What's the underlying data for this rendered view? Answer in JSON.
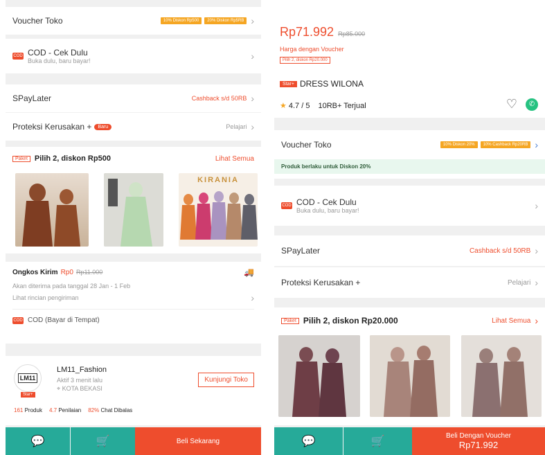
{
  "left": {
    "voucher": {
      "label": "Voucher Toko",
      "chips": [
        "10% Diskon Rp500",
        "20% Diskon Rp5RB"
      ]
    },
    "cod": {
      "title": "COD - Cek Dulu",
      "subtitle": "Buka dulu, baru bayar!",
      "icon": "COD"
    },
    "spaylater": {
      "label": "SPayLater",
      "value": "Cashback s/d 50RB"
    },
    "proteksi": {
      "label": "Proteksi Kerusakan +",
      "badge": "Baru",
      "value": "Pelajari"
    },
    "bundle": {
      "tag": "Paket",
      "title": "Pilih 2, diskon Rp500",
      "link": "Lihat Semua",
      "brand": "KIRANIA"
    },
    "shipping": {
      "label": "Ongkos Kirim",
      "price": "Rp0",
      "old": "Rp11.000",
      "eta": "Akan diterima pada tanggal 28 Jan - 1 Feb",
      "detail": "Lihat rincian pengiriman",
      "cod": "COD (Bayar di Tempat)",
      "cod_icon": "COD"
    },
    "shop": {
      "name": "LM11_Fashion",
      "active": "Aktif 3 menit lalu",
      "location": "KOTA BEKASI",
      "badge": "Star+",
      "logo": "LM11",
      "visit": "Kunjungi Toko",
      "stats": [
        {
          "num": "161",
          "label": "Produk"
        },
        {
          "num": "4.7",
          "label": "Penilaian"
        },
        {
          "num": "82%",
          "label": "Chat Dibalas"
        }
      ]
    },
    "buy_label": "Beli Sekarang"
  },
  "right": {
    "price": "Rp71.992",
    "old_price": "Rp85.000",
    "voucher_note": "Harga dengan Voucher",
    "discount_note": "Pilih 2, diskon Rp20.000",
    "title_badge": "Star+",
    "title": "DRESS WILONA",
    "rating": "4.7 / 5",
    "sold": "10RB+ Terjual",
    "voucher": {
      "label": "Voucher Toko",
      "chips": [
        "10% Diskon 20%",
        "10% Cashback Rp20RB"
      ]
    },
    "green_note": "Produk berlaku untuk Diskon 20%",
    "cod": {
      "title": "COD - Cek Dulu",
      "subtitle": "Buka dulu, baru bayar!",
      "icon": "COD"
    },
    "spaylater": {
      "label": "SPayLater",
      "value": "Cashback s/d 50RB"
    },
    "proteksi": {
      "label": "Proteksi Kerusakan +",
      "value": "Pelajari"
    },
    "bundle": {
      "tag": "Paket",
      "title": "Pilih 2, diskon Rp20.000",
      "link": "Lihat Semua"
    },
    "buy_label": "Beli Dengan Voucher",
    "buy_price": "Rp71.992"
  },
  "colors": {
    "accent": "#ee4d2d",
    "teal": "#26aa99",
    "voucher": "#f5a623",
    "green_note_bg": "#e8f7ee"
  }
}
